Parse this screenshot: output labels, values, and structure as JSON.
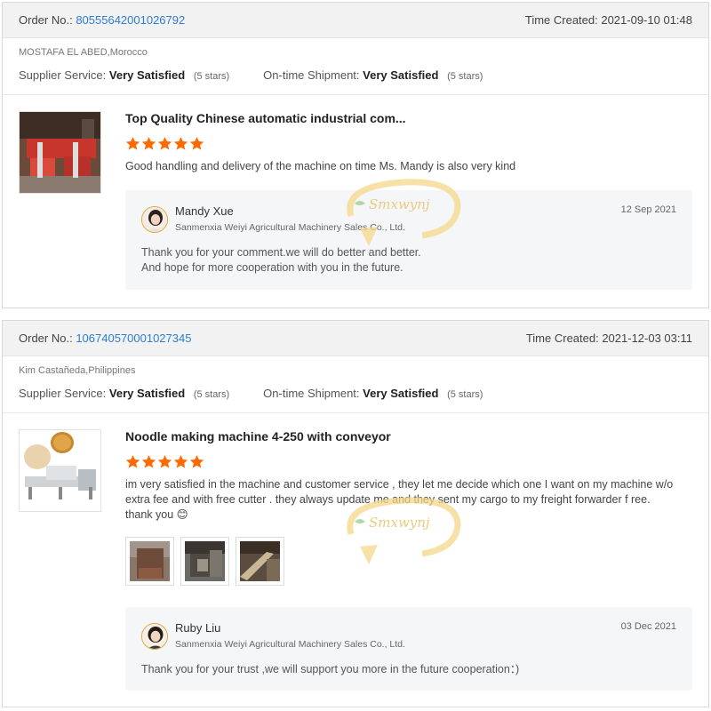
{
  "orders": [
    {
      "order_no_label": "Order No.:",
      "order_no": "80555642001026792",
      "time_created": "Time Created: 2021-09-10 01:48",
      "buyer": "MOSTAFA EL ABED,Morocco",
      "supplier_service_label": "Supplier Service:",
      "supplier_service_value": "Very Satisfied",
      "supplier_service_stars": "(5 stars)",
      "shipment_label": "On-time Shipment:",
      "shipment_value": "Very Satisfied",
      "shipment_stars": "(5 stars)",
      "product_title": "Top Quality Chinese automatic industrial com...",
      "rating": 5,
      "comment": "Good handling and delivery of the machine on time Ms. Mandy is also very kind",
      "reply": {
        "name": "Mandy Xue",
        "company": "Sanmenxia Weiyi Agricultural Machinery Sales Co., Ltd.",
        "date": "12 Sep 2021",
        "text_line1": "Thank you for your comment.we will do better and better.",
        "text_line2": "And hope for more cooperation with you in the future."
      }
    },
    {
      "order_no_label": "Order No.:",
      "order_no": "106740570001027345",
      "time_created": "Time Created: 2021-12-03 03:11",
      "buyer": "Kim Castañeda,Philippines",
      "supplier_service_label": "Supplier Service:",
      "supplier_service_value": "Very Satisfied",
      "supplier_service_stars": "(5 stars)",
      "shipment_label": "On-time Shipment:",
      "shipment_value": "Very Satisfied",
      "shipment_stars": "(5 stars)",
      "product_title": "Noodle making machine 4-250 with conveyor",
      "rating": 5,
      "comment": "im very satisfied in the machine and customer service , they let me decide which one I want on my machine w/o extra fee and with free cutter . they always update me and they sent my cargo to my freight forwarder f ree. thank you 😊",
      "reply": {
        "name": "Ruby Liu",
        "company": "Sanmenxia Weiyi Agricultural Machinery Sales Co., Ltd.",
        "date": "03 Dec 2021",
        "text": "Thank you for your trust ,we will support you more in the future cooperation：)"
      }
    }
  ],
  "watermark_text": "Smxwynj",
  "colors": {
    "link": "#2d7dd2",
    "star": "#ff6a00",
    "header_bg": "#f2f2f2",
    "reply_bg": "#f5f6f8"
  },
  "icons": {
    "star": "star-icon",
    "avatar": "avatar-icon"
  }
}
